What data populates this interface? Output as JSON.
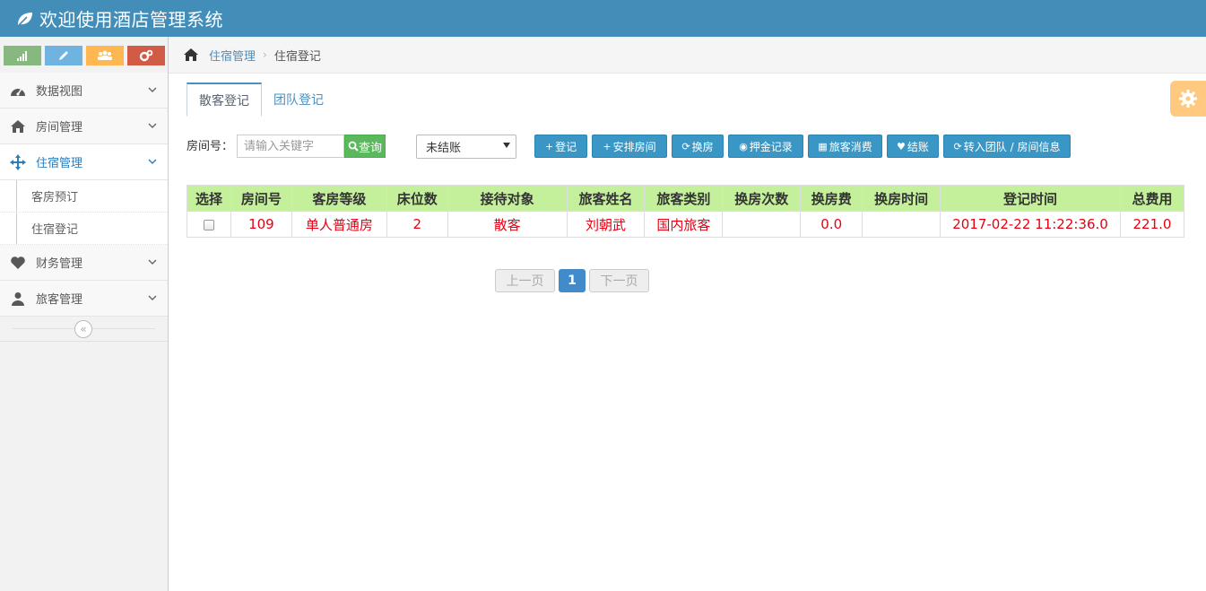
{
  "header": {
    "title": "欢迎使用酒店管理系统",
    "logo_icon": "leaf-icon",
    "bg_color": "#438eb9"
  },
  "shortcuts": [
    {
      "icon": "signal-icon",
      "color": "#87b87f"
    },
    {
      "icon": "pencil-icon",
      "color": "#6fb3e0"
    },
    {
      "icon": "users-icon",
      "color": "#ffb752"
    },
    {
      "icon": "cogs-icon",
      "color": "#d15b47"
    }
  ],
  "sidebar": {
    "items": [
      {
        "label": "数据视图",
        "icon": "dashboard-icon"
      },
      {
        "label": "房间管理",
        "icon": "home-icon"
      },
      {
        "label": "住宿管理",
        "icon": "move-icon",
        "active": true
      },
      {
        "label": "财务管理",
        "icon": "heart-icon"
      },
      {
        "label": "旅客管理",
        "icon": "user-icon"
      }
    ],
    "sub_items": [
      {
        "label": "客房预订"
      },
      {
        "label": "住宿登记"
      }
    ]
  },
  "breadcrumb": {
    "parent": "住宿管理",
    "current": "住宿登记"
  },
  "tabs": [
    {
      "label": "散客登记",
      "active": true
    },
    {
      "label": "团队登记",
      "active": false
    }
  ],
  "toolbar": {
    "room_label": "房间号：",
    "search_placeholder": "请输入关键字",
    "search_button": "查询",
    "status_value": "未结账",
    "actions": [
      {
        "label": "登记",
        "glyph": "+"
      },
      {
        "label": "安排房间",
        "glyph": "+"
      },
      {
        "label": "换房",
        "glyph": "⟳"
      },
      {
        "label": "押金记录",
        "glyph": "◉"
      },
      {
        "label": "旅客消费",
        "glyph": "▦"
      },
      {
        "label": "结账",
        "glyph": "♥"
      },
      {
        "label": "转入团队 / 房间信息",
        "glyph": "⟳"
      }
    ]
  },
  "table": {
    "headers": [
      "选择",
      "房间号",
      "客房等级",
      "床位数",
      "接待对象",
      "旅客姓名",
      "旅客类别",
      "换房次数",
      "换房费",
      "换房时间",
      "登记时间",
      "总费用"
    ],
    "rows": [
      [
        "",
        "109",
        "单人普通房",
        "2",
        "散客",
        "刘朝武",
        "国内旅客",
        "",
        "0.0",
        "",
        "2017-02-22 11:22:36.0",
        "221.0"
      ]
    ]
  },
  "pager": {
    "prev": "上一页",
    "current": "1",
    "next": "下一页"
  }
}
